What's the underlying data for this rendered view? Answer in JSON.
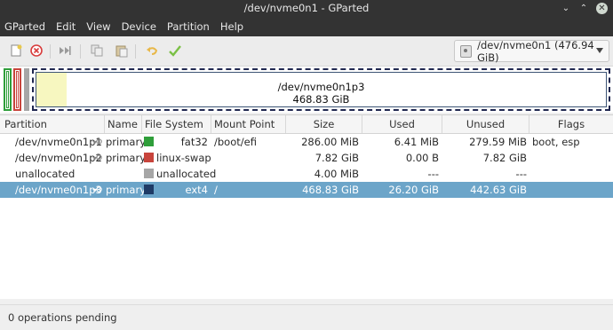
{
  "window": {
    "title": "/dev/nvme0n1 - GParted"
  },
  "menu": [
    "GParted",
    "Edit",
    "View",
    "Device",
    "Partition",
    "Help"
  ],
  "toolbar": {
    "buttons": [
      "new-partition-icon",
      "delete-icon",
      "resize-move-icon",
      "copy-icon",
      "paste-icon",
      "undo-icon",
      "apply-icon"
    ],
    "device_selector": "/dev/nvme0n1 (476.94 GiB)"
  },
  "map": {
    "selected_partition": "/dev/nvme0n1p3",
    "selected_size": "468.83 GiB"
  },
  "table": {
    "columns": [
      "Partition",
      "Name",
      "File System",
      "Mount Point",
      "Size",
      "Used",
      "Unused",
      "Flags"
    ],
    "rows": [
      {
        "partition": "/dev/nvme0n1p1",
        "name": "primary",
        "fs": "fat32",
        "fs_color": "#2f9e3a",
        "mount": "/boot/efi",
        "size": "286.00 MiB",
        "used": "6.41 MiB",
        "unused": "279.59 MiB",
        "flags": "boot, esp",
        "key": true,
        "selected": false
      },
      {
        "partition": "/dev/nvme0n1p2",
        "name": "primary",
        "fs": "linux-swap",
        "fs_color": "#c8443c",
        "mount": "",
        "size": "7.82 GiB",
        "used": "0.00 B",
        "unused": "7.82 GiB",
        "flags": "",
        "key": true,
        "selected": false
      },
      {
        "partition": "unallocated",
        "name": "",
        "fs": "unallocated",
        "fs_color": "#a6a6a6",
        "mount": "",
        "size": "4.00 MiB",
        "used": "---",
        "unused": "---",
        "flags": "",
        "key": false,
        "selected": false
      },
      {
        "partition": "/dev/nvme0n1p3",
        "name": "primary",
        "fs": "ext4",
        "fs_color": "#1f3b66",
        "mount": "/",
        "size": "468.83 GiB",
        "used": "26.20 GiB",
        "unused": "442.63 GiB",
        "flags": "",
        "key": true,
        "selected": true
      }
    ]
  },
  "status": {
    "text": "0 operations pending"
  }
}
